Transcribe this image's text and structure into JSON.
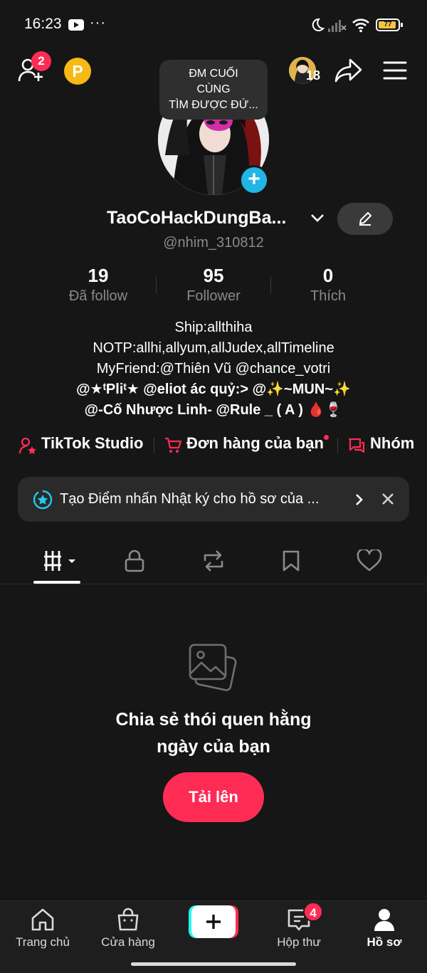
{
  "status_bar": {
    "time": "16:23",
    "battery": "77"
  },
  "header": {
    "friend_badge": "2",
    "coin_label": "P",
    "tooltip": "ĐM CUỐI\nCÙNG\nTÌM ĐƯỢC ĐỨ...",
    "story_count": "18"
  },
  "profile": {
    "display_name": "TaoCoHackDungBa...",
    "username": "@nhim_310812",
    "stats": [
      {
        "value": "19",
        "label": "Đã follow"
      },
      {
        "value": "95",
        "label": "Follower"
      },
      {
        "value": "0",
        "label": "Thích"
      }
    ],
    "bio_lines": [
      "Ship:allthiha",
      "NOTP:allhi,allyum,allJudex,allTimeline",
      "MyFriend:@Thiên Vũ @chance_votri",
      "@★ᵗPliᵗ★ @eliot ác quỷ:> @✨~MUN~✨",
      "@-Cố Nhược Linh- @Rule _ ( A ) 🩸🍷"
    ]
  },
  "quick_links": [
    {
      "label": "TikTok Studio",
      "icon": "person-star-icon"
    },
    {
      "label": "Đơn hàng của bạn",
      "icon": "cart-icon"
    },
    {
      "label": "Nhóm",
      "icon": "chat-group-icon"
    }
  ],
  "banner": {
    "text": "Tạo Điểm nhấn Nhật ký cho hồ sơ của ..."
  },
  "tabs": [
    {
      "name": "videos-tab",
      "icon": "grid-lines-icon"
    },
    {
      "name": "private-tab",
      "icon": "lock-icon"
    },
    {
      "name": "reposts-tab",
      "icon": "repost-icon"
    },
    {
      "name": "favorites-tab",
      "icon": "bookmark-icon"
    },
    {
      "name": "liked-tab",
      "icon": "heart-icon"
    }
  ],
  "empty_state": {
    "title_line1": "Chia sẻ thói quen hằng",
    "title_line2": "ngày của bạn",
    "button": "Tải lên"
  },
  "bottom_nav": {
    "items": [
      {
        "label": "Trang chủ",
        "icon": "home-icon"
      },
      {
        "label": "Cửa hàng",
        "icon": "shop-bag-icon"
      },
      {
        "label": "",
        "icon": "create-plus-icon"
      },
      {
        "label": "Hộp thư",
        "icon": "inbox-icon",
        "badge": "4"
      },
      {
        "label": "Hồ sơ",
        "icon": "profile-icon"
      }
    ]
  },
  "colors": {
    "background": "#161616",
    "accent": "#fe2c55",
    "cyan": "#20b6e6",
    "muted_text": "#8a8a8a"
  }
}
